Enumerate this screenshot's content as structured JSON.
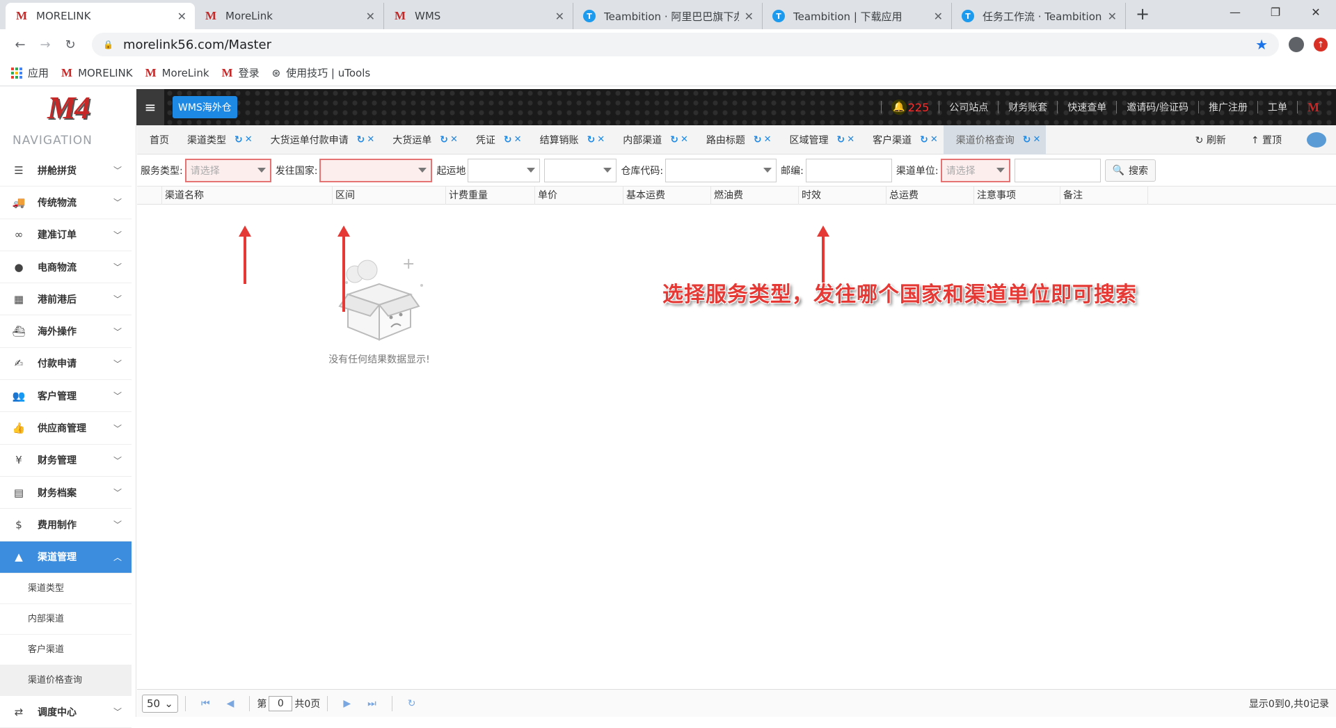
{
  "browser": {
    "tabs": [
      {
        "title": "MORELINK",
        "icon": "morelink",
        "active": true
      },
      {
        "title": "MoreLink",
        "icon": "morelink",
        "active": false
      },
      {
        "title": "WMS",
        "icon": "morelink",
        "active": false
      },
      {
        "title": "Teambition · 阿里巴巴旗下办",
        "icon": "teambition",
        "active": false
      },
      {
        "title": "Teambition | 下载应用",
        "icon": "teambition",
        "active": false
      },
      {
        "title": "任务工作流 · Teambition",
        "icon": "teambition",
        "active": false
      }
    ],
    "url": "morelink56.com/Master",
    "bookmarks": [
      {
        "label": "应用",
        "icon": "apps-grid"
      },
      {
        "label": "MORELINK",
        "icon": "morelink"
      },
      {
        "label": "MoreLink",
        "icon": "morelink"
      },
      {
        "label": "登录",
        "icon": "morelink"
      },
      {
        "label": "使用技巧 | uTools",
        "icon": "utools"
      }
    ]
  },
  "header": {
    "wms_label": "WMS海外仓",
    "notification_count": "225",
    "links": [
      "公司站点",
      "财务账套",
      "快速查单",
      "邀请码/验证码",
      "推广注册",
      "工单"
    ]
  },
  "sidebar": {
    "title": "NAVIGATION",
    "items": [
      {
        "label": "拼舱拼货",
        "icon": "stack-icon"
      },
      {
        "label": "传统物流",
        "icon": "truck-icon"
      },
      {
        "label": "建准订单",
        "icon": "link-icon"
      },
      {
        "label": "电商物流",
        "icon": "globe-icon"
      },
      {
        "label": "港前港后",
        "icon": "cubes-icon"
      },
      {
        "label": "海外操作",
        "icon": "ship-icon"
      },
      {
        "label": "付款申请",
        "icon": "hand-money-icon"
      },
      {
        "label": "客户管理",
        "icon": "users-icon"
      },
      {
        "label": "供应商管理",
        "icon": "thumbs-up-icon"
      },
      {
        "label": "财务管理",
        "icon": "yen-icon"
      },
      {
        "label": "财务档案",
        "icon": "book-icon"
      },
      {
        "label": "费用制作",
        "icon": "dollar-icon"
      }
    ],
    "active_item": {
      "label": "渠道管理",
      "icon": "road-icon"
    },
    "sub_items": [
      "渠道类型",
      "内部渠道",
      "客户渠道",
      "渠道价格查询"
    ],
    "after_item": {
      "label": "调度中心",
      "icon": "shuffle-icon"
    }
  },
  "page_tabs": {
    "home": "首页",
    "tabs": [
      "渠道类型",
      "大货运单付款申请",
      "大货运单",
      "凭证",
      "结算销账",
      "内部渠道",
      "路由标题",
      "区域管理",
      "客户渠道",
      "渠道价格查询"
    ],
    "active": "渠道价格查询",
    "refresh_label": "刷新",
    "top_label": "置顶"
  },
  "filters": {
    "service_type_label": "服务类型:",
    "service_type_placeholder": "请选择",
    "country_label": "发往国家:",
    "origin_label": "起运地",
    "warehouse_label": "仓库代码:",
    "zip_label": "邮编:",
    "channel_unit_label": "渠道单位:",
    "channel_unit_placeholder": "请选择",
    "search_label": "搜索"
  },
  "grid": {
    "columns": [
      "渠道名称",
      "区间",
      "计费重量",
      "单价",
      "基本运费",
      "燃油费",
      "时效",
      "总运费",
      "注意事项",
      "备注"
    ],
    "empty_text": "没有任何结果数据显示!"
  },
  "annotation": "选择服务类型，发往哪个国家和渠道单位即可搜索",
  "pager": {
    "page_size": "50",
    "page_prefix": "第",
    "page_value": "0",
    "page_total": "共0页",
    "info": "显示0到0,共0记录"
  },
  "colors": {
    "accent": "#3c8dde",
    "annotation": "#e53935",
    "error_border": "#e57373"
  }
}
